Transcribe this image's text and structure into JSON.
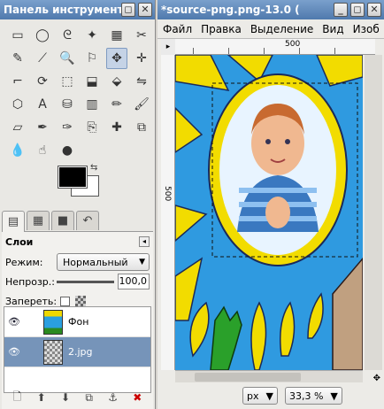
{
  "toolbox": {
    "title": "Панель инструмент",
    "window_buttons": [
      "◻",
      "✕"
    ],
    "tools": [
      {
        "name": "rect-select-icon",
        "glyph": "▭"
      },
      {
        "name": "ellipse-select-icon",
        "glyph": "◯"
      },
      {
        "name": "free-select-icon",
        "glyph": "ᘓ"
      },
      {
        "name": "fuzzy-select-icon",
        "glyph": "✦"
      },
      {
        "name": "color-select-icon",
        "glyph": "▦"
      },
      {
        "name": "scissors-icon",
        "glyph": "✂"
      },
      {
        "name": "paths-icon",
        "glyph": "✎"
      },
      {
        "name": "color-picker-icon",
        "glyph": "⟋"
      },
      {
        "name": "zoom-icon",
        "glyph": "🔍"
      },
      {
        "name": "measure-icon",
        "glyph": "⚐"
      },
      {
        "name": "move-icon",
        "glyph": "✥"
      },
      {
        "name": "align-icon",
        "glyph": "✛"
      },
      {
        "name": "crop-icon",
        "glyph": "⌐"
      },
      {
        "name": "rotate-icon",
        "glyph": "⟳"
      },
      {
        "name": "scale-icon",
        "glyph": "⬚"
      },
      {
        "name": "shear-icon",
        "glyph": "⬓"
      },
      {
        "name": "perspective-icon",
        "glyph": "⬙"
      },
      {
        "name": "flip-icon",
        "glyph": "⇋"
      },
      {
        "name": "cage-icon",
        "glyph": "⬡"
      },
      {
        "name": "text-icon",
        "glyph": "A"
      },
      {
        "name": "bucket-fill-icon",
        "glyph": "⛁"
      },
      {
        "name": "gradient-icon",
        "glyph": "▥"
      },
      {
        "name": "pencil-icon",
        "glyph": "✏"
      },
      {
        "name": "paintbrush-icon",
        "glyph": "🖌"
      },
      {
        "name": "eraser-icon",
        "glyph": "▱"
      },
      {
        "name": "airbrush-icon",
        "glyph": "✒"
      },
      {
        "name": "ink-icon",
        "glyph": "✑"
      },
      {
        "name": "clone-icon",
        "glyph": "⎘"
      },
      {
        "name": "heal-icon",
        "glyph": "✚"
      },
      {
        "name": "perspective-clone-icon",
        "glyph": "⧉"
      },
      {
        "name": "blur-icon",
        "glyph": "💧"
      },
      {
        "name": "smudge-icon",
        "glyph": "☝"
      },
      {
        "name": "dodge-burn-icon",
        "glyph": "●"
      }
    ],
    "color_swap_glyph": "⇆"
  },
  "layers_panel": {
    "title": "Слои",
    "mode_label": "Режим:",
    "mode_value": "Нормальный",
    "opacity_label": "Непрозр.:",
    "opacity_value": "100,0",
    "lock_label": "Запереть:",
    "layers": [
      {
        "name": "Фон",
        "visible": true,
        "selected": false
      },
      {
        "name": "2.jpg",
        "visible": true,
        "selected": true
      }
    ],
    "bottom_icons": [
      "new-layer-icon",
      "raise-layer-icon",
      "lower-layer-icon",
      "duplicate-layer-icon",
      "anchor-layer-icon",
      "delete-layer-icon"
    ]
  },
  "image_window": {
    "title": "*source-png.png-13.0 (",
    "window_buttons": [
      "_",
      "◻",
      "✕"
    ],
    "menu": [
      "Файл",
      "Правка",
      "Выделение",
      "Вид",
      "Изоб"
    ],
    "ruler_top_label": "500",
    "ruler_left_label": "500",
    "unit": "px",
    "zoom": "33,3 %"
  },
  "colors": {
    "foreground": "#000000",
    "background": "#ffffff",
    "selection": "#7694b9",
    "titlebar": "#5a82b4"
  }
}
